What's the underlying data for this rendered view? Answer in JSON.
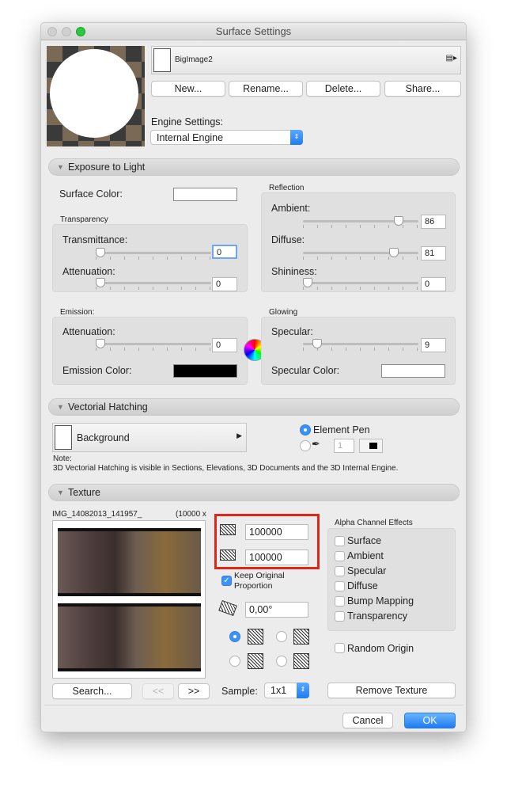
{
  "window": {
    "title": "Surface Settings"
  },
  "header": {
    "material_name": "BigImage2",
    "buttons": {
      "new": "New...",
      "rename": "Rename...",
      "delete": "Delete...",
      "share": "Share..."
    },
    "engine_label": "Engine Settings:",
    "engine_value": "Internal Engine"
  },
  "exposure": {
    "title": "Exposure to Light",
    "surface_color_label": "Surface Color:",
    "transparency": {
      "title": "Transparency",
      "transmittance_label": "Transmittance:",
      "transmittance": 0,
      "attenuation_label": "Attenuation:",
      "attenuation": 0
    },
    "reflection": {
      "title": "Reflection",
      "ambient_label": "Ambient:",
      "ambient": 86,
      "diffuse_label": "Diffuse:",
      "diffuse": 81,
      "shininess_label": "Shininess:",
      "shininess": 0
    },
    "emission": {
      "title": "Emission:",
      "attenuation_label": "Attenuation:",
      "attenuation": 0,
      "color_label": "Emission Color:",
      "color": "#000000"
    },
    "glowing": {
      "title": "Glowing",
      "specular_label": "Specular:",
      "specular": 9,
      "specular_color_label": "Specular Color:"
    }
  },
  "hatching": {
    "title": "Vectorial Hatching",
    "fill_name": "Background",
    "element_pen_label": "Element Pen",
    "pen_number": "1",
    "note_label": "Note:",
    "note": "3D Vectorial Hatching is visible in Sections, Elevations, 3D Documents and the 3D Internal Engine."
  },
  "texture": {
    "title": "Texture",
    "file_name": "IMG_14082013_141957_",
    "size": "(10000 x",
    "width": "100000",
    "height": "100000",
    "keep_proportion_label": "Keep Original Proportion",
    "keep_proportion_line1": "Keep Original",
    "keep_proportion_line2": "Proportion",
    "keep_proportion": true,
    "angle": "0,00°",
    "search_label": "Search...",
    "prev_label": "<<",
    "next_label": ">>",
    "sample_label": "Sample:",
    "sample_value": "1x1",
    "alpha_title": "Alpha Channel Effects",
    "alpha_effects": [
      "Surface",
      "Ambient",
      "Specular",
      "Diffuse",
      "Bump Mapping",
      "Transparency"
    ],
    "random_origin_label": "Random Origin",
    "remove_label": "Remove Texture"
  },
  "footer": {
    "cancel": "Cancel",
    "ok": "OK"
  },
  "colors": {
    "accent": "#1f7cf0",
    "highlight": "#e0261b"
  }
}
